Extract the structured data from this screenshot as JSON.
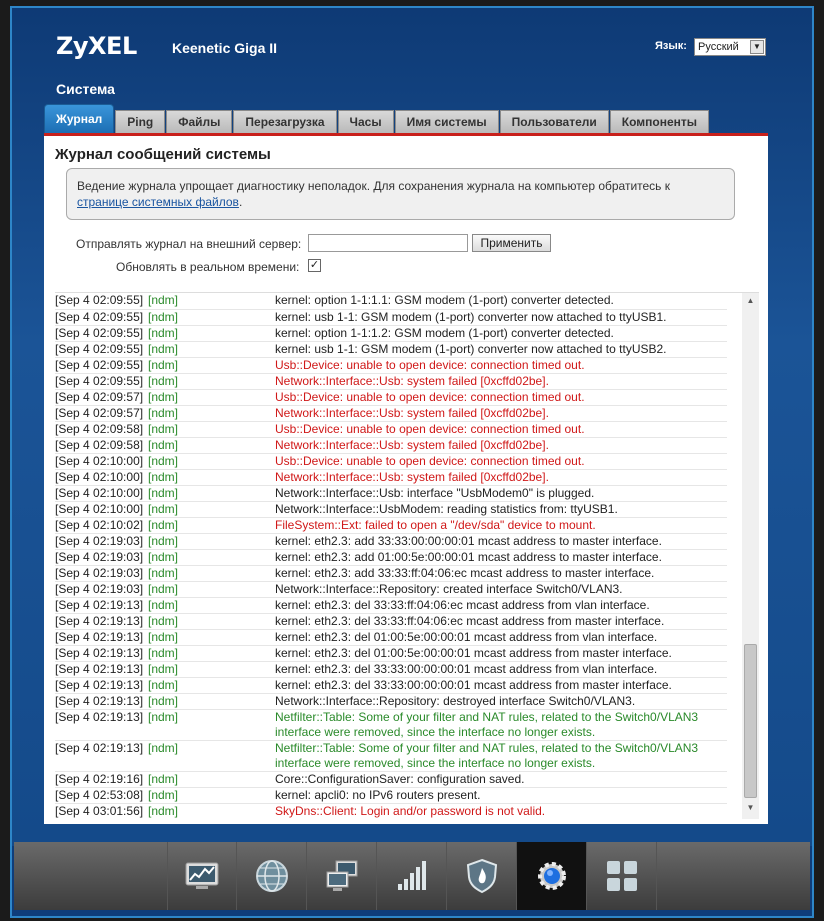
{
  "header": {
    "logo": "ZyXEL",
    "model": "Keenetic Giga II",
    "language_label": "Язык:",
    "language_value": "Русский"
  },
  "section_title": "Система",
  "tabs": [
    {
      "label": "Журнал",
      "active": true
    },
    {
      "label": "Ping"
    },
    {
      "label": "Файлы"
    },
    {
      "label": "Перезагрузка"
    },
    {
      "label": "Часы"
    },
    {
      "label": "Имя системы"
    },
    {
      "label": "Пользователи"
    },
    {
      "label": "Компоненты"
    }
  ],
  "panel": {
    "title": "Журнал сообщений системы",
    "info_text": "Ведение журнала упрощает диагностику неполадок. Для сохранения журнала на компьютер обратитесь к ",
    "info_link": "странице системных файлов",
    "info_tail": ".",
    "server_label": "Отправлять журнал на внешний сервер:",
    "server_value": "",
    "apply_label": "Применить",
    "realtime_label": "Обновлять в реальном времени:",
    "realtime_checked": "✓"
  },
  "log": [
    {
      "ts": "[Sep 4 02:09:55]",
      "src": "[ndm]",
      "msg": "kernel: option 1-1:1.1: GSM modem (1-port) converter detected.",
      "level": "info"
    },
    {
      "ts": "[Sep 4 02:09:55]",
      "src": "[ndm]",
      "msg": "kernel: usb 1-1: GSM modem (1-port) converter now attached to ttyUSB1.",
      "level": "info"
    },
    {
      "ts": "[Sep 4 02:09:55]",
      "src": "[ndm]",
      "msg": "kernel: option 1-1:1.2: GSM modem (1-port) converter detected.",
      "level": "info"
    },
    {
      "ts": "[Sep 4 02:09:55]",
      "src": "[ndm]",
      "msg": "kernel: usb 1-1: GSM modem (1-port) converter now attached to ttyUSB2.",
      "level": "info"
    },
    {
      "ts": "[Sep 4 02:09:55]",
      "src": "[ndm]",
      "msg": "Usb::Device: unable to open device: connection timed out.",
      "level": "error"
    },
    {
      "ts": "[Sep 4 02:09:55]",
      "src": "[ndm]",
      "msg": "Network::Interface::Usb: system failed [0xcffd02be].",
      "level": "error"
    },
    {
      "ts": "[Sep 4 02:09:57]",
      "src": "[ndm]",
      "msg": "Usb::Device: unable to open device: connection timed out.",
      "level": "error"
    },
    {
      "ts": "[Sep 4 02:09:57]",
      "src": "[ndm]",
      "msg": "Network::Interface::Usb: system failed [0xcffd02be].",
      "level": "error"
    },
    {
      "ts": "[Sep 4 02:09:58]",
      "src": "[ndm]",
      "msg": "Usb::Device: unable to open device: connection timed out.",
      "level": "error"
    },
    {
      "ts": "[Sep 4 02:09:58]",
      "src": "[ndm]",
      "msg": "Network::Interface::Usb: system failed [0xcffd02be].",
      "level": "error"
    },
    {
      "ts": "[Sep 4 02:10:00]",
      "src": "[ndm]",
      "msg": "Usb::Device: unable to open device: connection timed out.",
      "level": "error"
    },
    {
      "ts": "[Sep 4 02:10:00]",
      "src": "[ndm]",
      "msg": "Network::Interface::Usb: system failed [0xcffd02be].",
      "level": "error"
    },
    {
      "ts": "[Sep 4 02:10:00]",
      "src": "[ndm]",
      "msg": "Network::Interface::Usb: interface \"UsbModem0\" is plugged.",
      "level": "info"
    },
    {
      "ts": "[Sep 4 02:10:00]",
      "src": "[ndm]",
      "msg": "Network::Interface::UsbModem: reading statistics from: ttyUSB1.",
      "level": "info"
    },
    {
      "ts": "[Sep 4 02:10:02]",
      "src": "[ndm]",
      "msg": "FileSystem::Ext: failed to open a \"/dev/sda\" device to mount.",
      "level": "error"
    },
    {
      "ts": "[Sep 4 02:19:03]",
      "src": "[ndm]",
      "msg": "kernel: eth2.3: add 33:33:00:00:00:01 mcast address to master interface.",
      "level": "info"
    },
    {
      "ts": "[Sep 4 02:19:03]",
      "src": "[ndm]",
      "msg": "kernel: eth2.3: add 01:00:5e:00:00:01 mcast address to master interface.",
      "level": "info"
    },
    {
      "ts": "[Sep 4 02:19:03]",
      "src": "[ndm]",
      "msg": "kernel: eth2.3: add 33:33:ff:04:06:ec mcast address to master interface.",
      "level": "info"
    },
    {
      "ts": "[Sep 4 02:19:03]",
      "src": "[ndm]",
      "msg": "Network::Interface::Repository: created interface Switch0/VLAN3.",
      "level": "info"
    },
    {
      "ts": "[Sep 4 02:19:13]",
      "src": "[ndm]",
      "msg": "kernel: eth2.3: del 33:33:ff:04:06:ec mcast address from vlan interface.",
      "level": "info"
    },
    {
      "ts": "[Sep 4 02:19:13]",
      "src": "[ndm]",
      "msg": "kernel: eth2.3: del 33:33:ff:04:06:ec mcast address from master interface.",
      "level": "info"
    },
    {
      "ts": "[Sep 4 02:19:13]",
      "src": "[ndm]",
      "msg": "kernel: eth2.3: del 01:00:5e:00:00:01 mcast address from vlan interface.",
      "level": "info"
    },
    {
      "ts": "[Sep 4 02:19:13]",
      "src": "[ndm]",
      "msg": "kernel: eth2.3: del 01:00:5e:00:00:01 mcast address from master interface.",
      "level": "info"
    },
    {
      "ts": "[Sep 4 02:19:13]",
      "src": "[ndm]",
      "msg": "kernel: eth2.3: del 33:33:00:00:00:01 mcast address from vlan interface.",
      "level": "info"
    },
    {
      "ts": "[Sep 4 02:19:13]",
      "src": "[ndm]",
      "msg": "kernel: eth2.3: del 33:33:00:00:00:01 mcast address from master interface.",
      "level": "info"
    },
    {
      "ts": "[Sep 4 02:19:13]",
      "src": "[ndm]",
      "msg": "Network::Interface::Repository: destroyed interface Switch0/VLAN3.",
      "level": "info"
    },
    {
      "ts": "[Sep 4 02:19:13]",
      "src": "[ndm]",
      "msg": "Netfilter::Table: Some of your filter and NAT rules, related to the Switch0/VLAN3 interface were removed, since the interface no longer exists.",
      "level": "notice"
    },
    {
      "ts": "[Sep 4 02:19:13]",
      "src": "[ndm]",
      "msg": "Netfilter::Table: Some of your filter and NAT rules, related to the Switch0/VLAN3 interface were removed, since the interface no longer exists.",
      "level": "notice"
    },
    {
      "ts": "[Sep 4 02:19:16]",
      "src": "[ndm]",
      "msg": "Core::ConfigurationSaver: configuration saved.",
      "level": "info"
    },
    {
      "ts": "[Sep 4 02:53:08]",
      "src": "[ndm]",
      "msg": "kernel: apcli0: no IPv6 routers present.",
      "level": "info"
    },
    {
      "ts": "[Sep 4 03:01:56]",
      "src": "[ndm]",
      "msg": "SkyDns::Client: Login and/or password is not valid.",
      "level": "error"
    }
  ],
  "bottom_nav": [
    {
      "icon": "monitor-chart-icon"
    },
    {
      "icon": "globe-icon"
    },
    {
      "icon": "network-computers-icon"
    },
    {
      "icon": "signal-bars-icon"
    },
    {
      "icon": "shield-icon"
    },
    {
      "icon": "gear-icon",
      "active": true
    },
    {
      "icon": "apps-grid-icon"
    }
  ],
  "colors": {
    "accent": "#1b6db2",
    "error": "#d01818",
    "notice": "#2a8a2a"
  }
}
